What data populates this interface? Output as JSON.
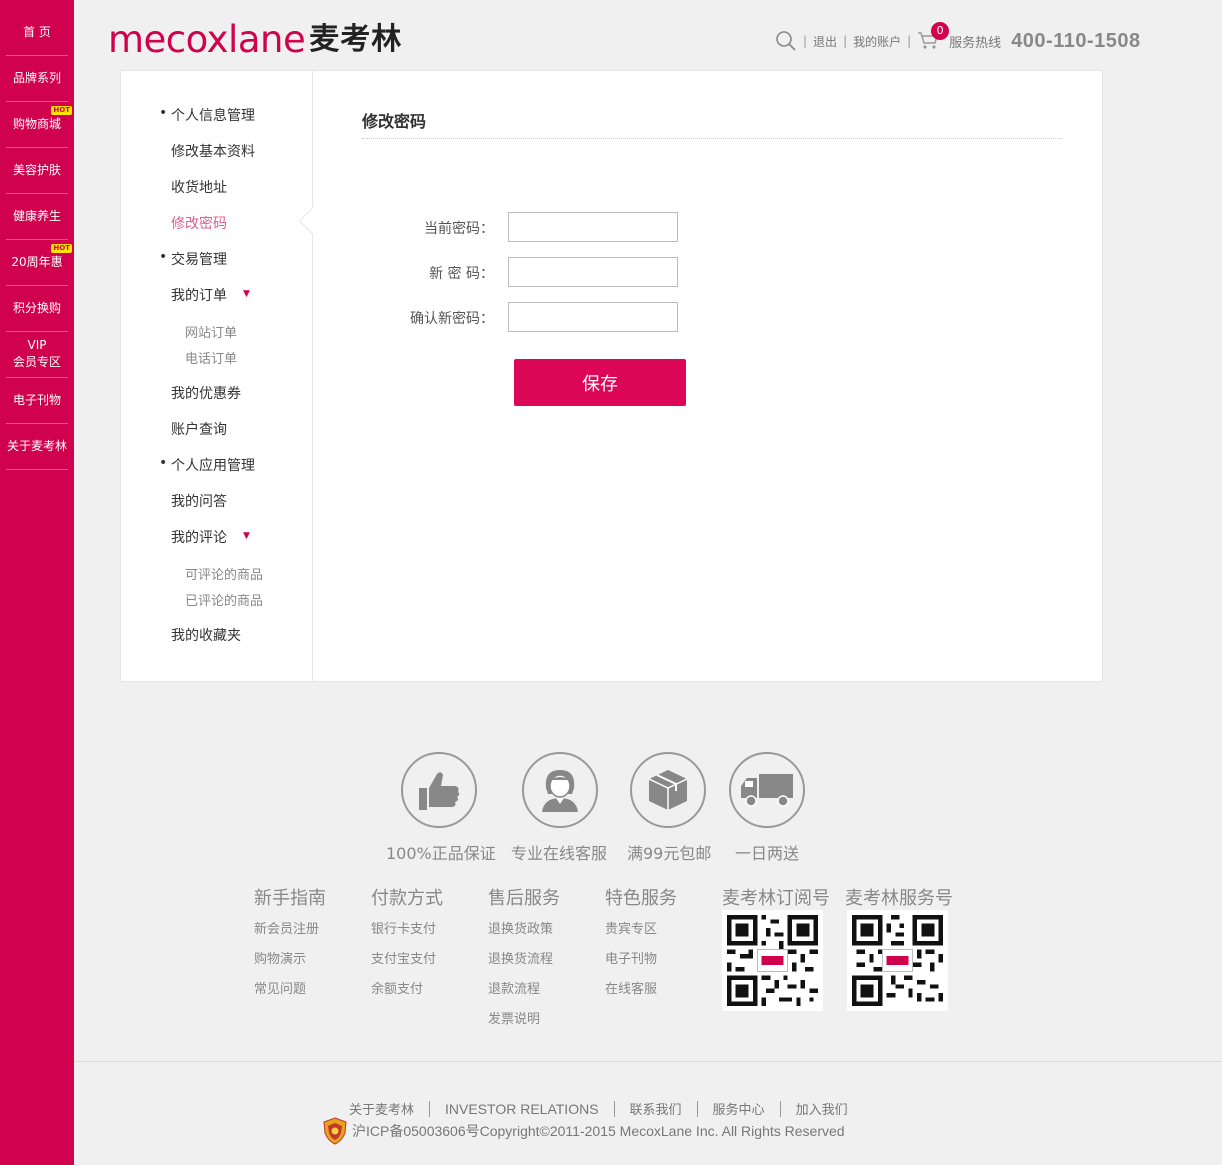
{
  "sidebar": {
    "items": [
      {
        "label": "首 页"
      },
      {
        "label": "品牌系列"
      },
      {
        "label": "购物商城",
        "badge": "HOT"
      },
      {
        "label": "美容护肤"
      },
      {
        "label": "健康养生"
      },
      {
        "label": "20周年惠",
        "badge": "HOT"
      },
      {
        "label": "积分换购"
      },
      {
        "label": "VIP",
        "label2": "会员专区"
      },
      {
        "label": "电子刊物"
      },
      {
        "label": "关于麦考林"
      }
    ]
  },
  "header": {
    "logo_en": "mecoxlane",
    "logo_cn": "麦考林",
    "logout": "退出",
    "my_account": "我的账户",
    "cart_count": "0",
    "hotline_label": "服务热线",
    "hotline_number": "400-110-1508"
  },
  "menu": {
    "section1": "个人信息管理",
    "edit_profile": "修改基本资料",
    "address": "收货地址",
    "change_password": "修改密码",
    "section2": "交易管理",
    "my_orders": "我的订单",
    "web_orders": "网站订单",
    "phone_orders": "电话订单",
    "coupons": "我的优惠券",
    "account_query": "账户查询",
    "section3": "个人应用管理",
    "my_qa": "我的问答",
    "my_reviews": "我的评论",
    "reviewable": "可评论的商品",
    "reviewed": "已评论的商品",
    "favorites": "我的收藏夹",
    "bullet": "•",
    "arrow": "▼"
  },
  "form": {
    "title": "修改密码",
    "current_label": "当前密码：",
    "new_label": "新 密 码：",
    "confirm_label": "确认新密码：",
    "current_value": "",
    "new_value": "",
    "confirm_value": "",
    "save": "保存"
  },
  "features": [
    {
      "label": "100%正品保证",
      "icon": "thumbs-up-icon"
    },
    {
      "label": "专业在线客服",
      "icon": "customer-service-icon"
    },
    {
      "label": "满99元包邮",
      "icon": "package-icon"
    },
    {
      "label": "一日两送",
      "icon": "truck-icon"
    }
  ],
  "footer": {
    "columns": [
      {
        "title": "新手指南",
        "links": [
          "新会员注册",
          "购物演示",
          "常见问题"
        ]
      },
      {
        "title": "付款方式",
        "links": [
          "银行卡支付",
          "支付宝支付",
          "余额支付"
        ]
      },
      {
        "title": "售后服务",
        "links": [
          "退换货政策",
          "退换货流程",
          "退款流程",
          "发票说明"
        ]
      },
      {
        "title": "特色服务",
        "links": [
          "贵宾专区",
          "电子刊物",
          "在线客服"
        ]
      }
    ],
    "qr1_title": "麦考林订阅号",
    "qr2_title": "麦考林服务号",
    "bottom_links": [
      "关于麦考林",
      "INVESTOR RELATIONS",
      "联系我们",
      "服务中心",
      "加入我们"
    ],
    "copyright": "沪ICP备05003606号Copyright©2011-2015 MecoxLane Inc. All Rights Reserved"
  },
  "colors": {
    "brand": "#d1024d",
    "button": "#dd0758",
    "active": "#e25c8f"
  }
}
